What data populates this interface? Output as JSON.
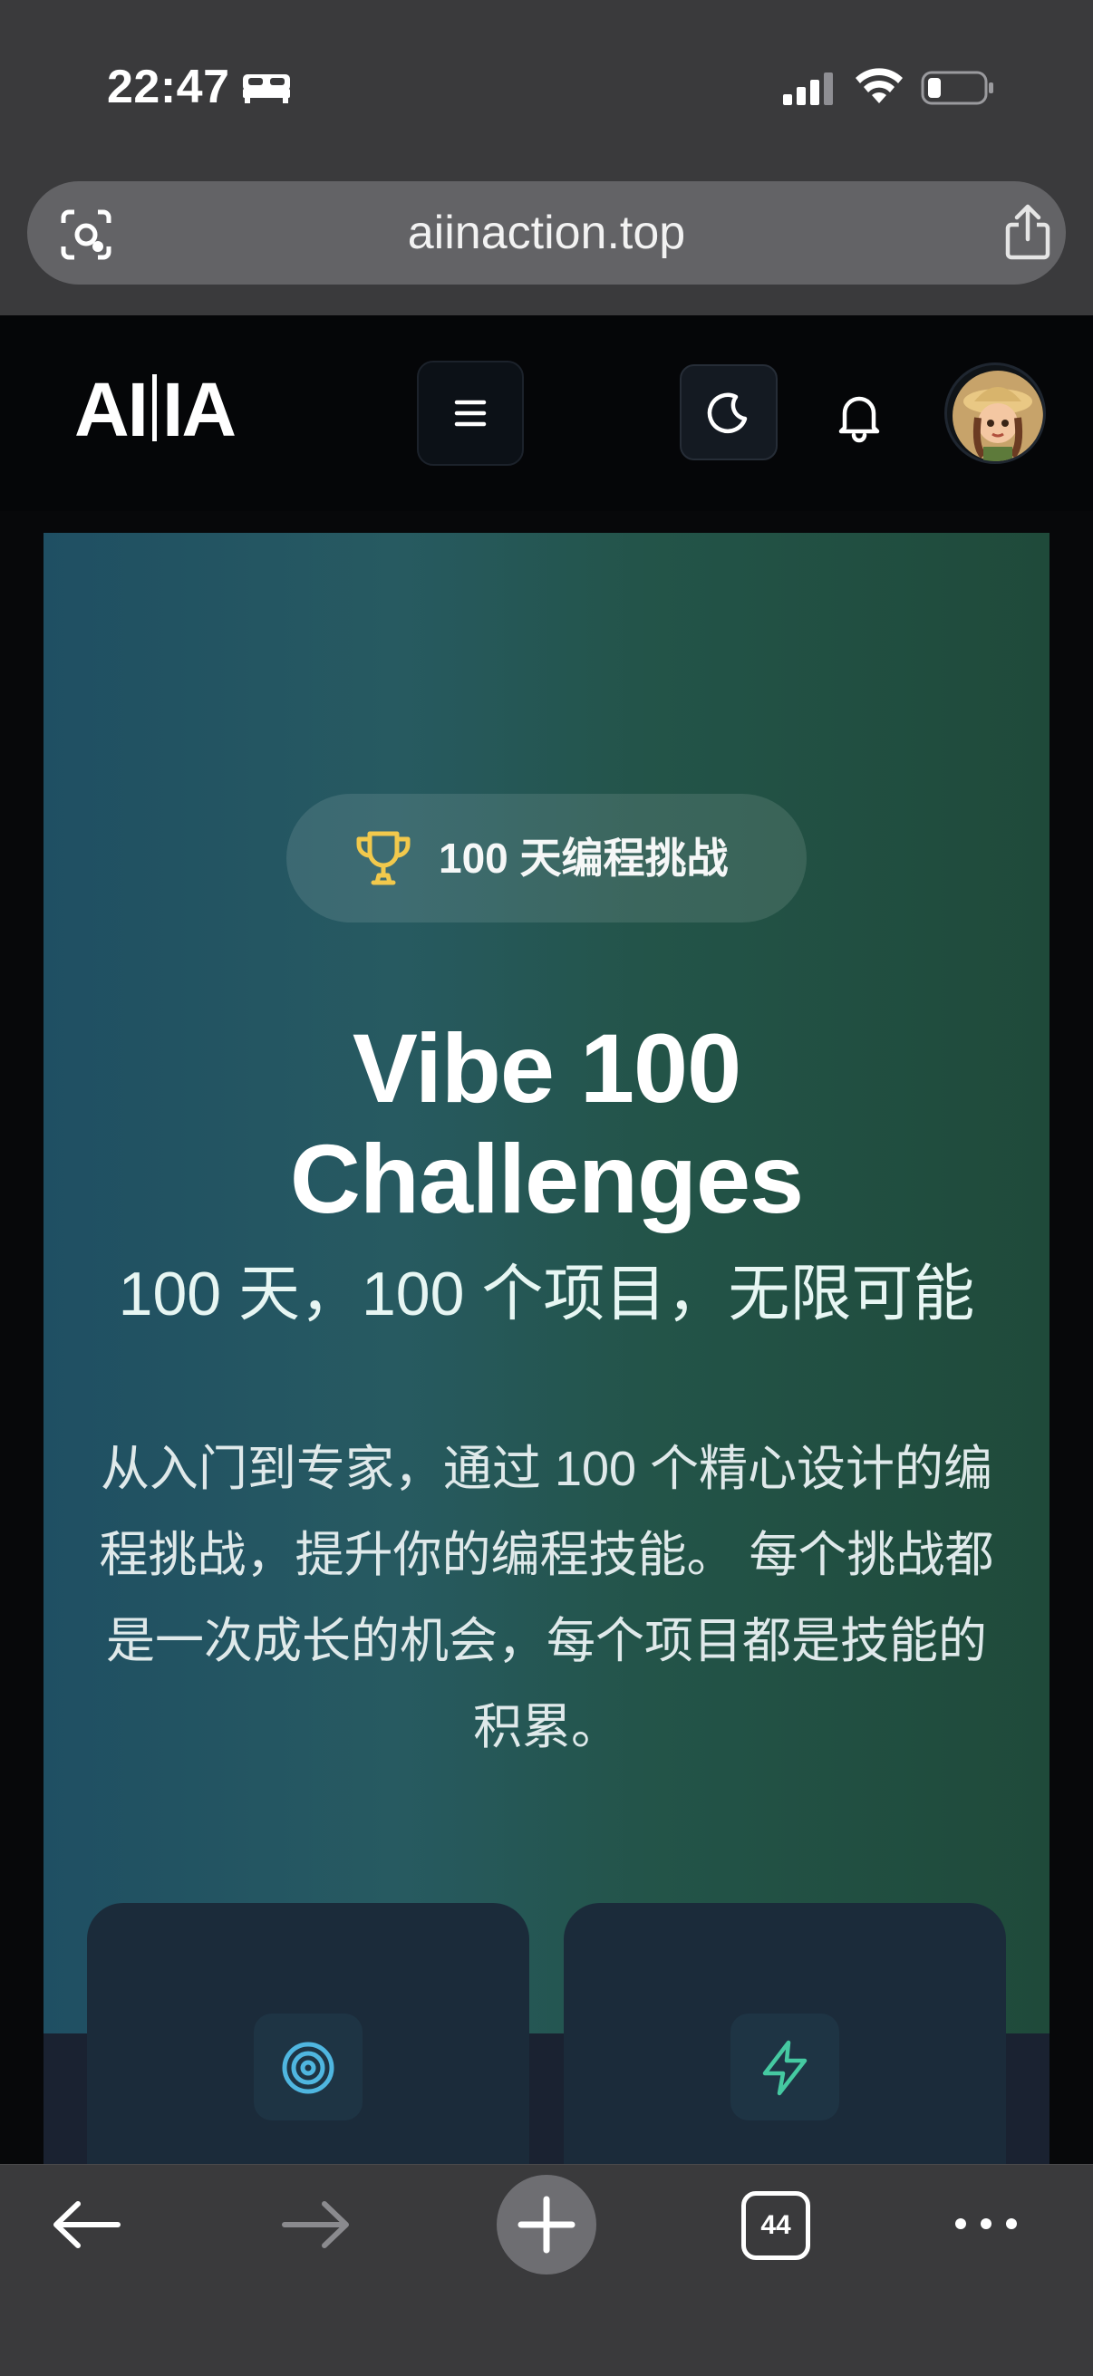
{
  "status_bar": {
    "time": "22:47",
    "icons": [
      "bed-icon",
      "cellular-signal-icon",
      "wifi-icon",
      "battery-icon"
    ]
  },
  "browser": {
    "url": "aiinaction.top",
    "tabs_count": "44",
    "icons": [
      "lens-icon",
      "share-icon",
      "back-arrow-icon",
      "forward-arrow-icon",
      "plus-icon",
      "more-icon"
    ]
  },
  "navbar": {
    "logo": [
      "AI",
      "IA"
    ],
    "icons": [
      "hamburger-menu-icon",
      "moon-icon",
      "bell-icon",
      "avatar"
    ]
  },
  "hero": {
    "badge": "100 天编程挑战",
    "title_line1": "Vibe 100",
    "title_line2": "Challenges",
    "subtitle": "100 天，100 个项目，无限可能",
    "description": "从入门到专家，通过 100 个精心设计的编程挑战，提升你的编程技能。 每个挑战都是一次成长的机会，每个项目都是技能的积累。"
  },
  "features": {
    "icons": [
      "target-icon",
      "lightning-icon"
    ]
  },
  "colors": {
    "hero_gradient_start": "#1f4f63",
    "hero_gradient_end": "#1f4a3a",
    "trophy": "#f2c94c",
    "target_icon": "#4fb6e0",
    "lightning_icon": "#45c9a1"
  }
}
